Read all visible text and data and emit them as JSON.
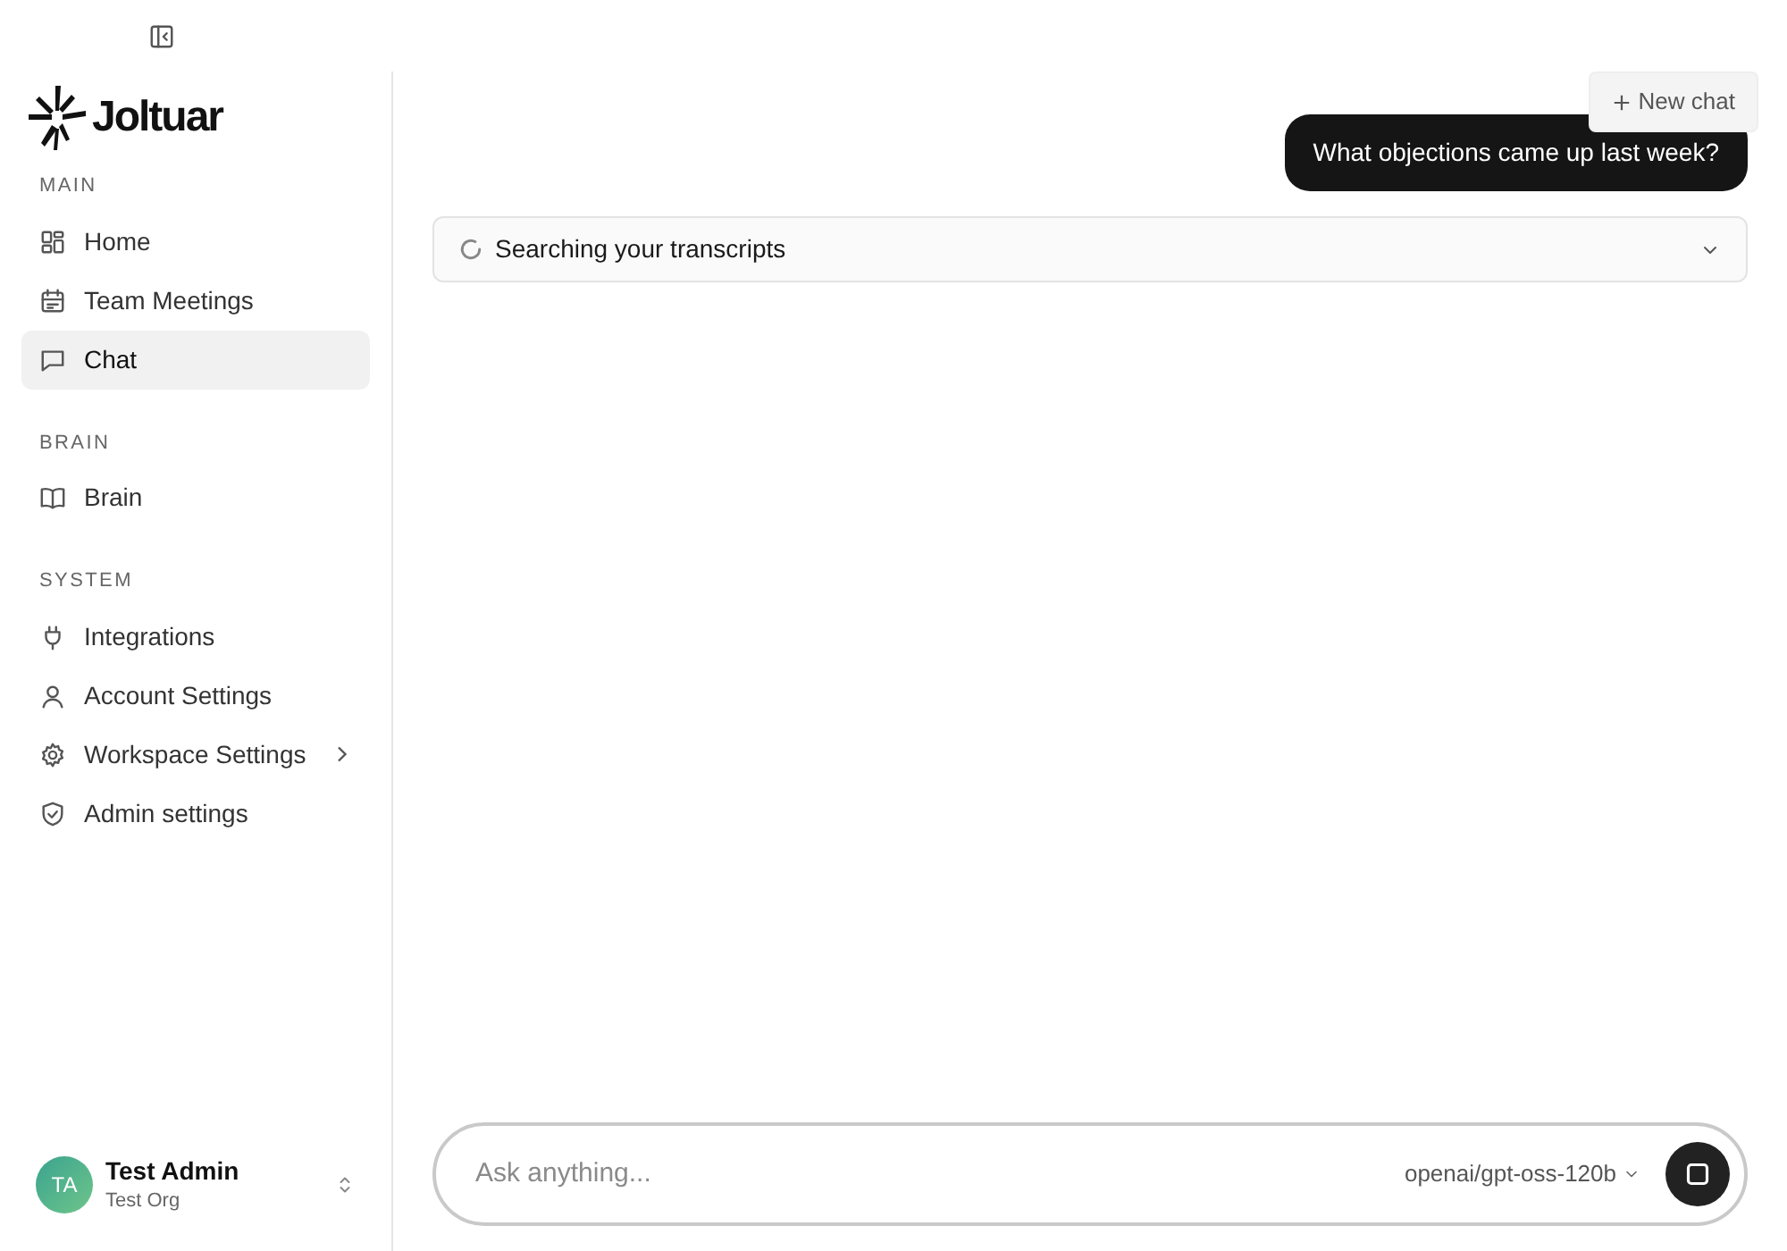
{
  "brand": {
    "name": "Joltuar"
  },
  "sidebar": {
    "sections": [
      {
        "title": "MAIN",
        "items": [
          {
            "label": "Home",
            "selected": false,
            "submenu": false
          },
          {
            "label": "Team Meetings",
            "selected": false,
            "submenu": false
          },
          {
            "label": "Chat",
            "selected": true,
            "submenu": false
          }
        ]
      },
      {
        "title": "BRAIN",
        "items": [
          {
            "label": "Brain",
            "selected": false,
            "submenu": false
          }
        ]
      },
      {
        "title": "SYSTEM",
        "items": [
          {
            "label": "Integrations",
            "selected": false,
            "submenu": false
          },
          {
            "label": "Account Settings",
            "selected": false,
            "submenu": false
          },
          {
            "label": "Workspace Settings",
            "selected": false,
            "submenu": true
          },
          {
            "label": "Admin settings",
            "selected": false,
            "submenu": false
          }
        ]
      }
    ],
    "user": {
      "initials": "TA",
      "name": "Test Admin",
      "org": "Test Org"
    }
  },
  "chat": {
    "new_chat_button": "New chat",
    "user_messages": [
      "What objections came up last week?"
    ],
    "status": {
      "text": "Searching your transcripts",
      "expanded": false
    },
    "composer": {
      "placeholder": "Ask anything...",
      "model": "openai/gpt-oss-120b"
    }
  }
}
